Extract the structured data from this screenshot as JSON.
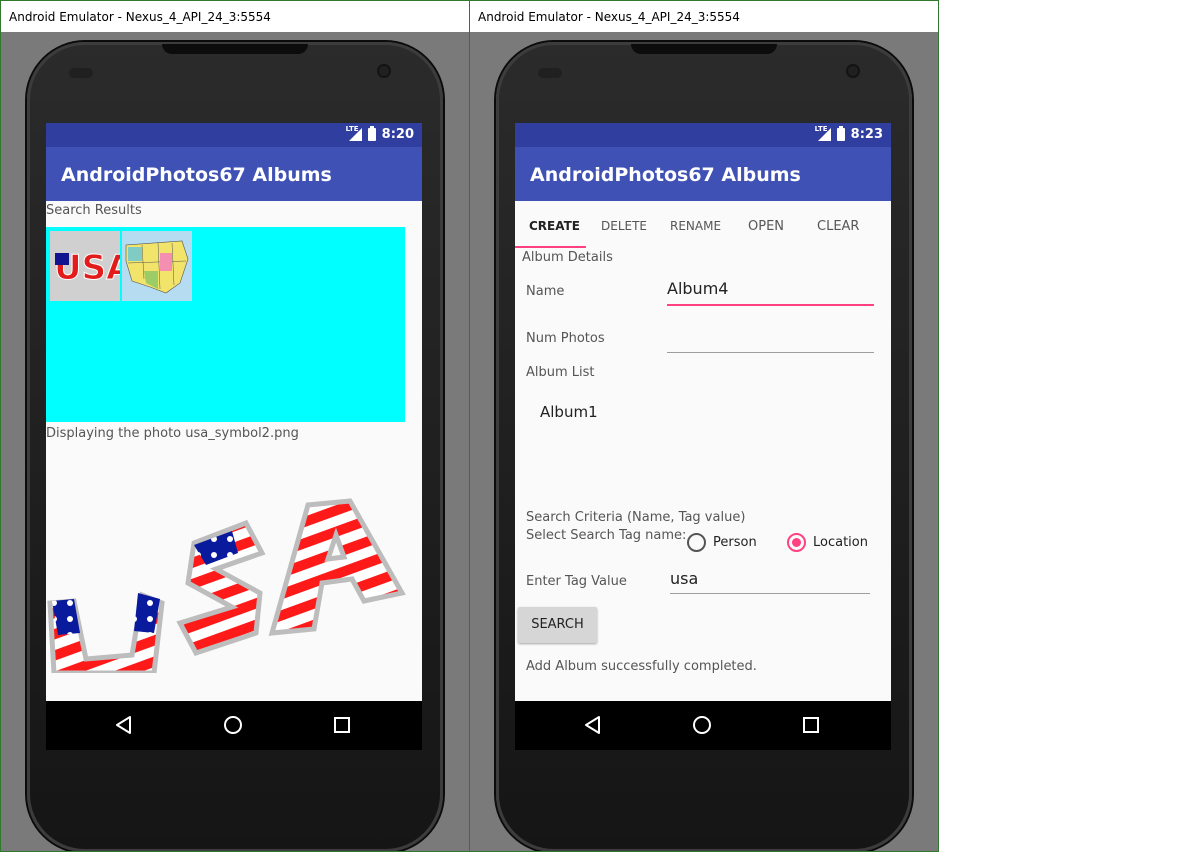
{
  "left_window": {
    "title": "Android Emulator - Nexus_4_API_24_3:5554",
    "status_time": "8:20",
    "status_network": "LTE",
    "app_title": "AndroidPhotos67 Albums",
    "search_results_label": "Search Results",
    "displaying_label": "Displaying the photo usa_symbol2.png",
    "grid_background": "#00ffff"
  },
  "right_window": {
    "title": "Android Emulator - Nexus_4_API_24_3:5554",
    "status_time": "8:23",
    "status_network": "LTE",
    "app_title": "AndroidPhotos67 Albums",
    "tabs": [
      {
        "label": "CREATE",
        "active": true
      },
      {
        "label": "DELETE",
        "active": false
      },
      {
        "label": "RENAME",
        "active": false
      },
      {
        "label": "OPEN",
        "active": false
      },
      {
        "label": "CLEAR",
        "active": false
      }
    ],
    "album_details_label": "Album Details",
    "name_label": "Name",
    "name_value": "Album4",
    "num_photos_label": "Num Photos",
    "num_photos_value": "",
    "album_list_label": "Album List",
    "album_list": [
      "Album1"
    ],
    "search_criteria_label": "Search Criteria (Name, Tag value)",
    "tag_name_label": "Select Search Tag name:",
    "radio_options": [
      {
        "label": "Person",
        "selected": false
      },
      {
        "label": "Location",
        "selected": true
      }
    ],
    "tag_value_label": "Enter Tag Value",
    "tag_value": "usa",
    "search_button": "SEARCH",
    "status_message": "Add Album successfully completed."
  },
  "colors": {
    "status_bar": "#303f9f",
    "app_bar": "#3f51b5",
    "accent": "#ff4081"
  },
  "icons": [
    "signal-icon",
    "battery-icon",
    "back-icon",
    "home-icon",
    "recents-icon"
  ]
}
